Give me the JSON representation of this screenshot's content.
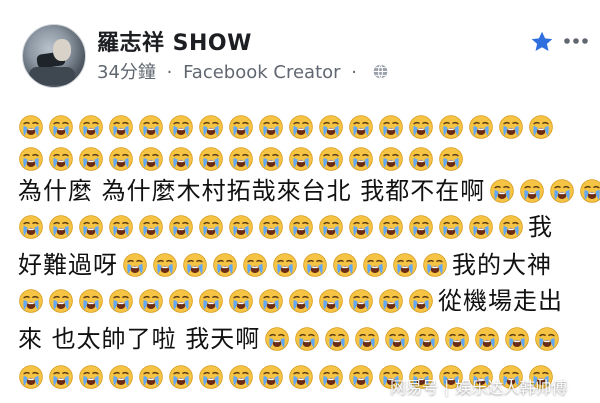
{
  "post": {
    "author_name": "羅志祥 SHOW",
    "time": "34分鐘",
    "source": "Facebook Creator",
    "separator": "·"
  },
  "icons": {
    "star": "star-icon",
    "more": "more-options-icon",
    "globe": "globe-icon",
    "emoji": "loudly-crying-face-icon"
  },
  "colors": {
    "accent": "#2f6fde",
    "secondary_text": "#606770",
    "emoji_yellow": "#f6c445",
    "emoji_tear": "#5aa7ff"
  },
  "content": {
    "line1_count": 18,
    "line2_count": 15,
    "line3_text": "為什麼 為什麼木村拓哉來台北 我都不在啊",
    "line3_trailing": 4,
    "line4_count": 17,
    "line4_suffix": "我",
    "line5_prefix": "好難過呀",
    "line5_count": 11,
    "line5_suffix": "我的大神",
    "line6_count": 14,
    "line6_suffix": "從機場走出",
    "line7_prefix": "來 也太帥了啦 我天啊",
    "line7_count": 10,
    "line8_count": 18
  },
  "watermark": {
    "left": "网易号",
    "right": "娱乐达人韩帅傅"
  }
}
